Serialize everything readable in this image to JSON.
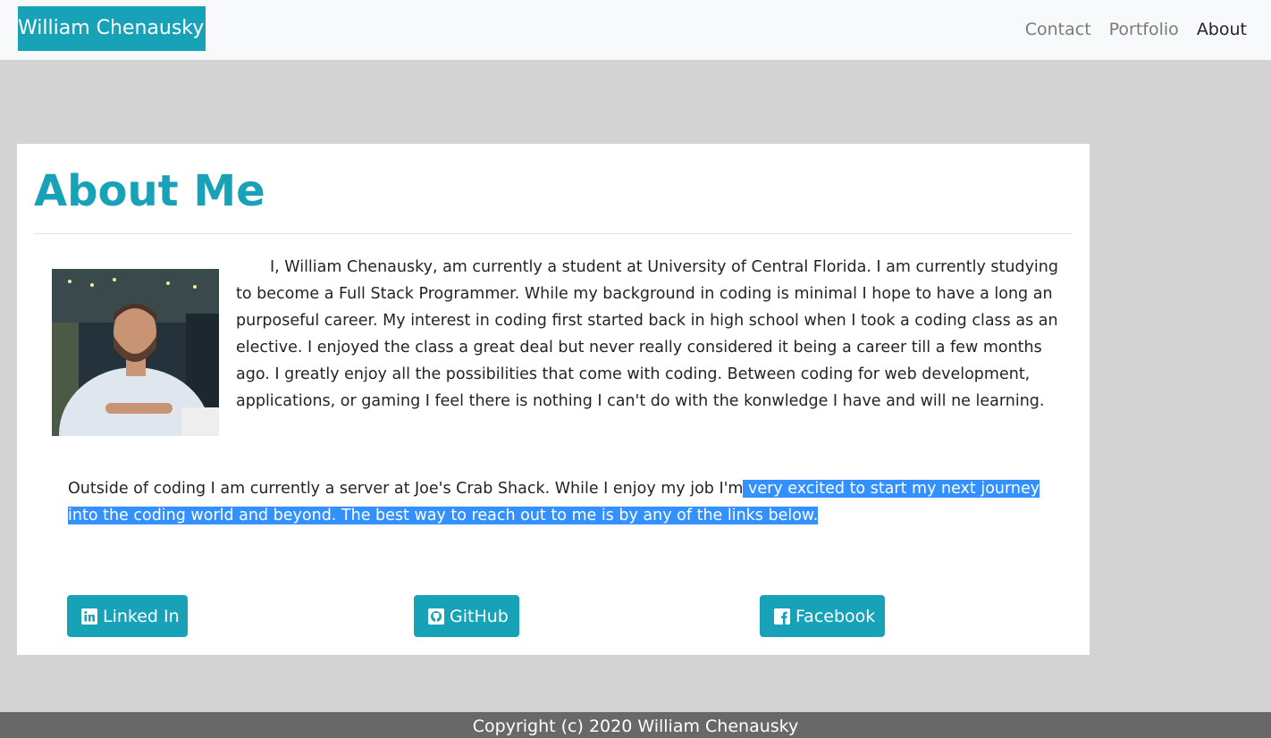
{
  "navbar": {
    "brand": "William Chenausky",
    "links": [
      "Contact",
      "Portfolio",
      "About"
    ],
    "active": "About"
  },
  "about": {
    "title": "About Me",
    "bio_paragraph_1": "I, William Chenausky, am currently a student at University of Central Florida. I am currently studying to become a Full Stack Programmer. While my background in coding is minimal I hope to have a long an purposeful career. My interest in coding first started back in high school when I took a coding class as an elective. I enjoyed the class a great deal but never really considered it being a career till a few months ago. I greatly enjoy all the possibilities that come with coding. Between coding for web development, applications, or gaming I feel there is nothing I can't do with the konwledge I have and will ne learning.",
    "bio_paragraph_2_start": "Outside of coding I am currently a server at Joe's Crab Shack. While I enjoy my job I'm",
    "bio_paragraph_2_selected": " very excited to start my next journey into the coding world and beyond. The best way to reach out to me is by any of the links below."
  },
  "social": {
    "linkedin": "Linked In",
    "github": "GitHub",
    "facebook": "Facebook"
  },
  "footer": {
    "copyright": "Copyright (c) 2020 William Chenausky"
  },
  "colors": {
    "accent": "#17a2b8",
    "selection": "#3390ff",
    "page_bg": "#d3d3d3",
    "footer_bg": "#686868"
  },
  "icons": [
    "linkedin-icon",
    "github-icon",
    "facebook-icon"
  ]
}
